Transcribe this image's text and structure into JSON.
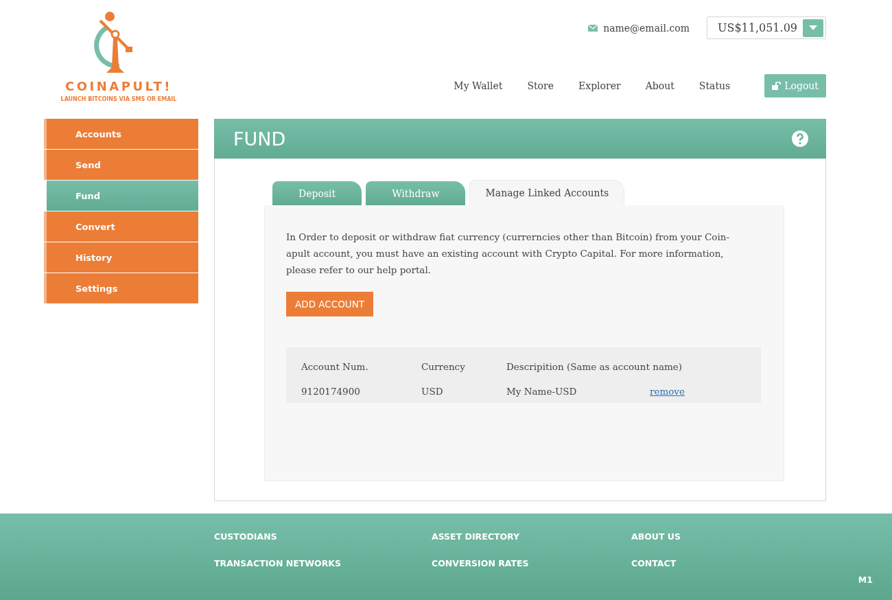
{
  "logo": {
    "name": "COINAPULT!",
    "tagline": "LAUNCH BITCOINS VIA SMS OR EMAIL"
  },
  "header": {
    "email": "name@email.com",
    "balance": "US$11,051.09",
    "nav": [
      "My Wallet",
      "Store",
      "Explorer",
      "About",
      "Status"
    ],
    "logout": "Logout"
  },
  "sidebar": {
    "items": [
      {
        "label": "Accounts",
        "selected": false
      },
      {
        "label": "Send",
        "selected": false
      },
      {
        "label": "Fund",
        "selected": true
      },
      {
        "label": "Convert",
        "selected": false
      },
      {
        "label": "History",
        "selected": false
      },
      {
        "label": "Settings",
        "selected": false
      }
    ]
  },
  "panel": {
    "title": "FUND",
    "tabs": [
      {
        "label": "Deposit",
        "selected": false
      },
      {
        "label": "Withdraw",
        "selected": false
      },
      {
        "label": "Manage Linked Accounts",
        "selected": true
      }
    ],
    "intro": "In Order to deposit or withdraw fiat currency (currerncies other than Bitcoin) from your Coin-apult account, you must have an existing account with Crypto Capital. For more information, please refer to our help portal.",
    "add_button": "ADD ACCOUNT",
    "table": {
      "columns": [
        "Account Num.",
        "Currency",
        "Descripition (Same as account name)"
      ],
      "rows": [
        {
          "account": "9120174900",
          "currency": "USD",
          "description": "My Name-USD",
          "action": "remove"
        }
      ]
    }
  },
  "footer": {
    "columns": [
      [
        "CUSTODIANS",
        "TRANSACTION NETWORKS"
      ],
      [
        "ASSET DIRECTORY",
        "CONVERSION RATES"
      ],
      [
        "ABOUT US",
        "CONTACT"
      ]
    ],
    "badge": "M1"
  }
}
